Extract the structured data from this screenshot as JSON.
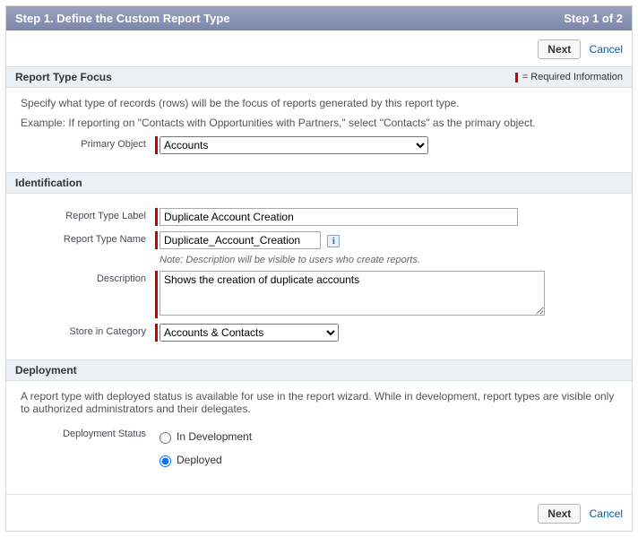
{
  "wizard": {
    "title": "Step 1. Define the Custom Report Type",
    "step_indicator": "Step 1 of 2"
  },
  "actions": {
    "next_label": "Next",
    "cancel_label": "Cancel"
  },
  "required_legend": "= Required Information",
  "focus": {
    "section_title": "Report Type Focus",
    "help1": "Specify what type of records (rows) will be the focus of reports generated by this report type.",
    "help2": "Example: If reporting on \"Contacts with Opportunities with Partners,\" select \"Contacts\" as the primary object.",
    "primary_object_label": "Primary Object",
    "primary_object_value": "Accounts"
  },
  "identification": {
    "section_title": "Identification",
    "label_field_label": "Report Type Label",
    "label_field_value": "Duplicate Account Creation",
    "name_field_label": "Report Type Name",
    "name_field_value": "Duplicate_Account_Creation",
    "info_icon_char": "i",
    "note": "Note: Description will be visible to users who create reports.",
    "description_label": "Description",
    "description_value": "Shows the creation of duplicate accounts",
    "category_label": "Store in Category",
    "category_value": "Accounts & Contacts"
  },
  "deployment": {
    "section_title": "Deployment",
    "help": "A report type with deployed status is available for use in the report wizard. While in development, report types are visible only to authorized administrators and their delegates.",
    "status_label": "Deployment Status",
    "option_in_development": "In Development",
    "option_deployed": "Deployed",
    "selected": "Deployed"
  }
}
